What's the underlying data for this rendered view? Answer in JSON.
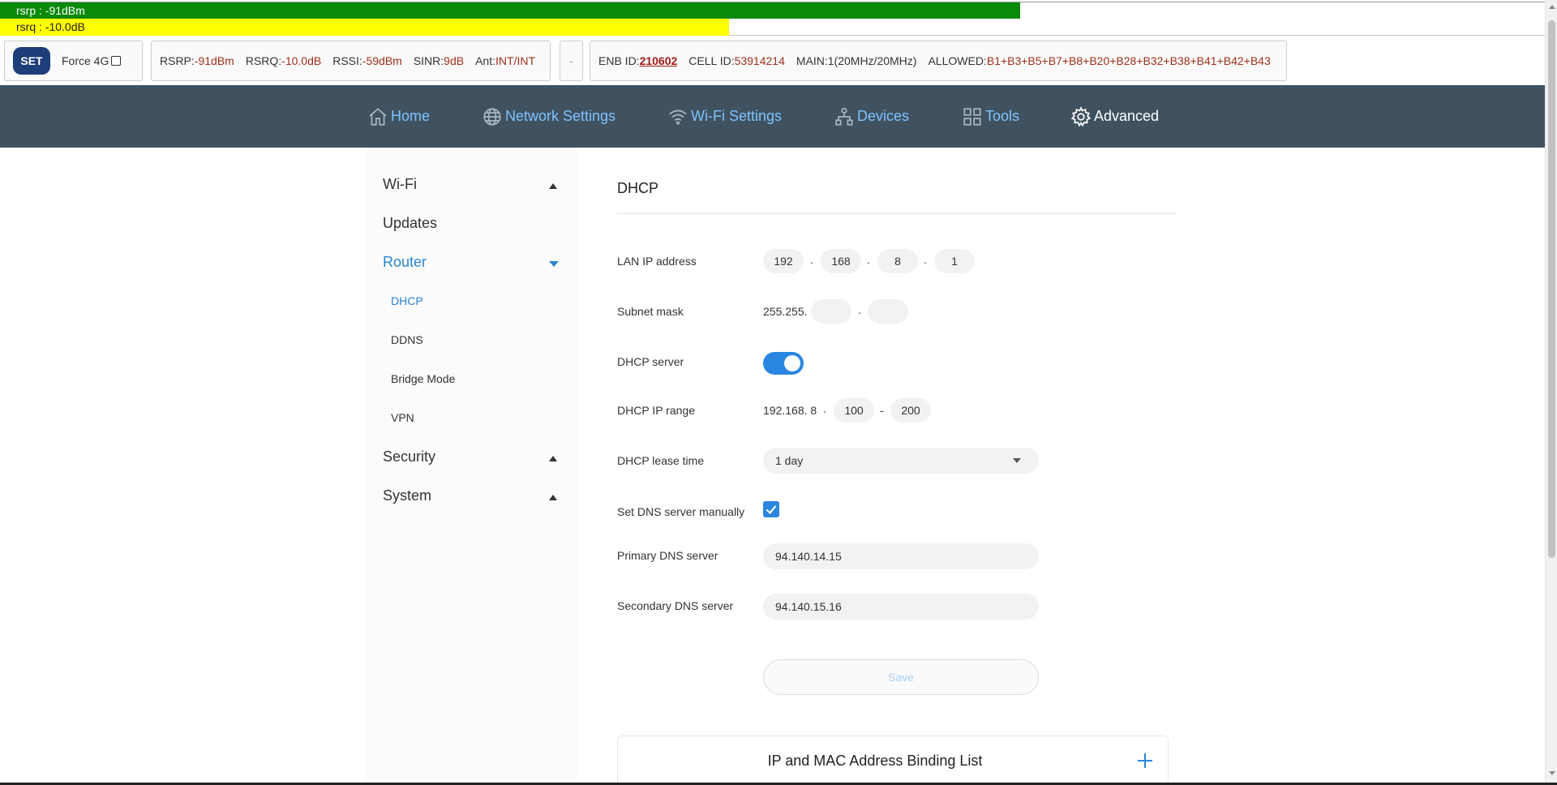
{
  "signal": {
    "rsrp_text": "rsrp : -91dBm",
    "rsrq_text": "rsrq : -10.0dB",
    "rsrp_level": 0.655,
    "rsrq_level": 0.468,
    "rsrp_color": "#0a8a0a",
    "rsrq_color": "#ffff00"
  },
  "toolbar": {
    "set_label": "SET",
    "force_label": "Force 4G",
    "force_checked": false
  },
  "metrics": [
    {
      "label": "RSRP:",
      "value": "-91dBm"
    },
    {
      "label": "RSRQ:",
      "value": "-10.0dB"
    },
    {
      "label": "RSSI:",
      "value": "-59dBm"
    },
    {
      "label": "SINR:",
      "value": "9dB"
    },
    {
      "label": "Ant:",
      "value": "INT/INT"
    }
  ],
  "dash_label": "-",
  "cellinfo": {
    "enb_label": "ENB ID:",
    "enb_value": "210602",
    "cell_label": "CELL ID:",
    "cell_value": "53914214",
    "main_label": "MAIN:",
    "main_value": "1(20MHz/20MHz)",
    "allowed_label": "ALLOWED:",
    "allowed_value": "B1+B3+B5+B7+B8+B20+B28+B32+B38+B41+B42+B43"
  },
  "nav": {
    "home": "Home",
    "network": "Network Settings",
    "wifi": "Wi-Fi Settings",
    "devices": "Devices",
    "tools": "Tools",
    "advanced": "Advanced"
  },
  "sidebar": {
    "wifi": "Wi-Fi",
    "updates": "Updates",
    "router": "Router",
    "dhcp": "DHCP",
    "ddns": "DDNS",
    "bridge": "Bridge Mode",
    "vpn": "VPN",
    "security": "Security",
    "system": "System"
  },
  "form": {
    "title": "DHCP",
    "lan_label": "LAN IP address",
    "lan_ip": [
      "192",
      "168",
      "8",
      "1"
    ],
    "subnet_label": "Subnet mask",
    "subnet_prefix": "255.255.",
    "subnet_fields": [
      "",
      ""
    ],
    "dhcp_server_label": "DHCP server",
    "dhcp_server_on": true,
    "range_label": "DHCP IP range",
    "range_prefix": "192.168. 8",
    "range_start": "100",
    "range_end": "200",
    "lease_label": "DHCP lease time",
    "lease_value": "1 day",
    "dns_manual_label": "Set DNS server manually",
    "dns_manual_checked": true,
    "primary_dns_label": "Primary DNS server",
    "primary_dns": "94.140.14.15",
    "secondary_dns_label": "Secondary DNS server",
    "secondary_dns": "94.140.15.16",
    "save_label": "Save"
  },
  "binding": {
    "title": "IP and MAC Address Binding List"
  },
  "colors": {
    "accent": "#2a86e0",
    "nav_bg": "#405260",
    "nav_link": "#7ec2ff",
    "value_red": "#a0301a"
  }
}
